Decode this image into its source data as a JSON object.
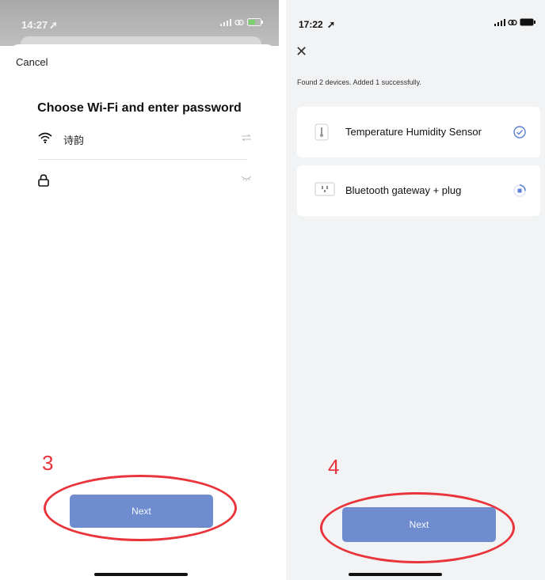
{
  "left_screen": {
    "status_time": "14:27",
    "cancel_label": "Cancel",
    "title": "Choose Wi-Fi and enter password",
    "wifi_name": "诗韵",
    "password_value": "",
    "step_number": "3",
    "next_label": "Next"
  },
  "right_screen": {
    "status_time": "17:22",
    "found_message": "Found 2 devices. Added 1 successfully.",
    "devices": [
      {
        "name": "Temperature Humidity Sensor",
        "icon": "thermometer-icon",
        "status": "added"
      },
      {
        "name": "Bluetooth gateway + plug",
        "icon": "plug-icon",
        "status": "pending"
      }
    ],
    "step_number": "4",
    "next_label": "Next"
  },
  "colors": {
    "accent": "#6f8ccf",
    "annotation": "#e8343a",
    "check": "#5b7fd6"
  }
}
